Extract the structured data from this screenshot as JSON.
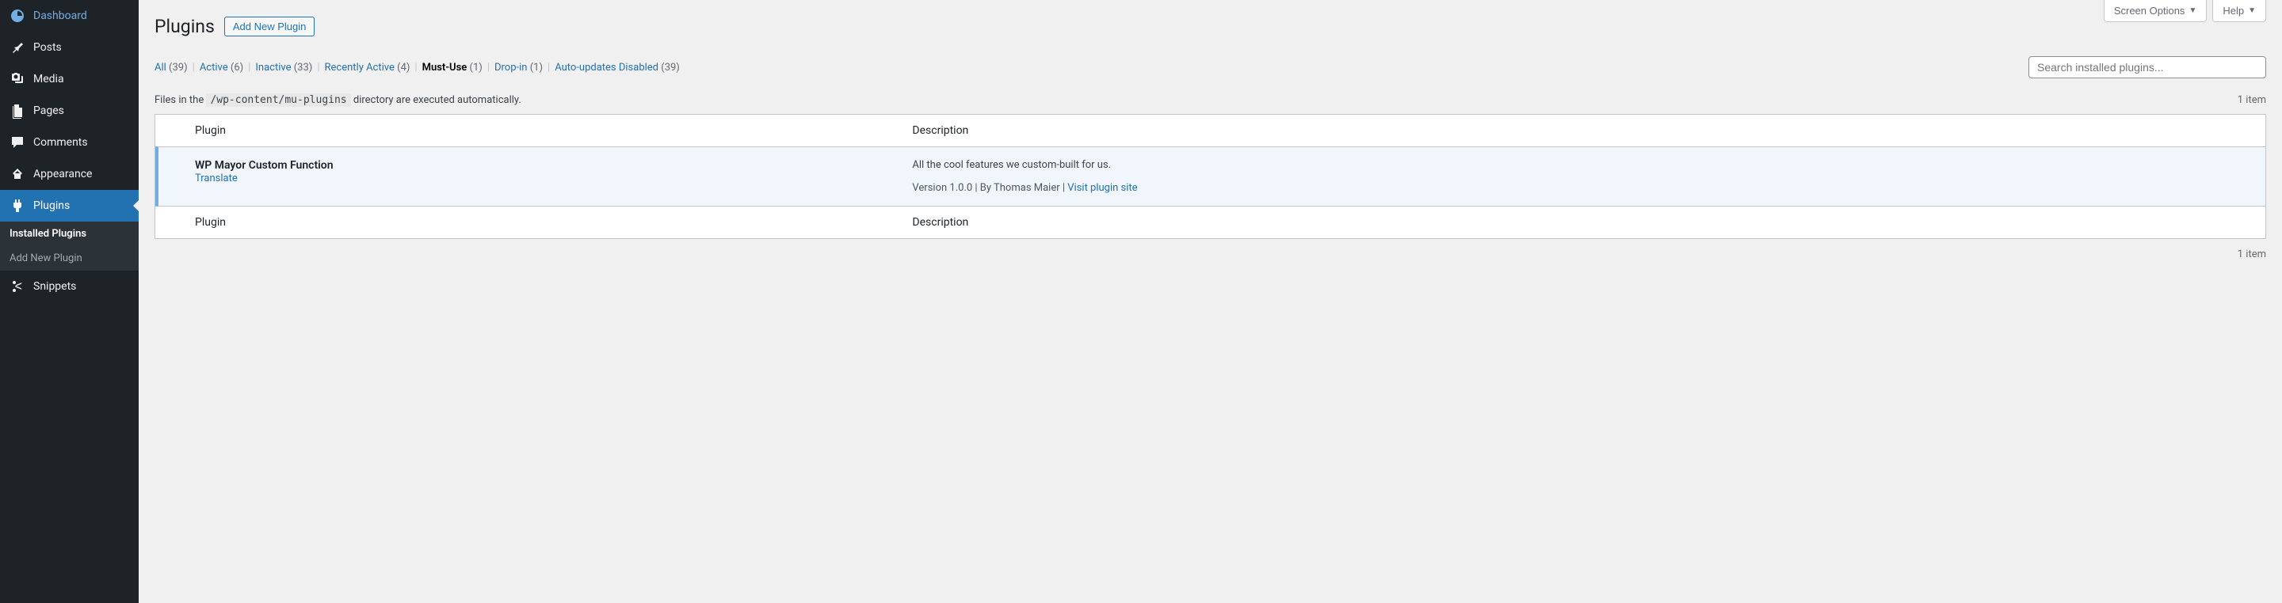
{
  "sidebar": {
    "items": [
      {
        "label": "Dashboard"
      },
      {
        "label": "Posts"
      },
      {
        "label": "Media"
      },
      {
        "label": "Pages"
      },
      {
        "label": "Comments"
      },
      {
        "label": "Appearance"
      },
      {
        "label": "Plugins"
      },
      {
        "label": "Snippets"
      }
    ],
    "submenu": [
      {
        "label": "Installed Plugins"
      },
      {
        "label": "Add New Plugin"
      }
    ]
  },
  "topButtons": {
    "screenOptions": "Screen Options",
    "help": "Help"
  },
  "page": {
    "title": "Plugins",
    "addNew": "Add New Plugin"
  },
  "filters": {
    "all": {
      "label": "All",
      "count": "(39)"
    },
    "active": {
      "label": "Active",
      "count": "(6)"
    },
    "inactive": {
      "label": "Inactive",
      "count": "(33)"
    },
    "recentlyActive": {
      "label": "Recently Active",
      "count": "(4)"
    },
    "mustUse": {
      "label": "Must-Use",
      "count": "(1)"
    },
    "dropIn": {
      "label": "Drop-in",
      "count": "(1)"
    },
    "autoUpdates": {
      "label": "Auto-updates Disabled",
      "count": "(39)"
    }
  },
  "search": {
    "placeholder": "Search installed plugins..."
  },
  "dirNote": {
    "prefix": "Files in the ",
    "code": "/wp-content/mu-plugins",
    "suffix": " directory are executed automatically."
  },
  "itemsCount": "1 item",
  "table": {
    "headers": {
      "plugin": "Plugin",
      "description": "Description"
    },
    "rows": [
      {
        "name": "WP Mayor Custom Function",
        "action": "Translate",
        "description": "All the cool features we custom-built for us.",
        "meta": {
          "version": "Version 1.0.0",
          "by": "By Thomas Maier",
          "link": "Visit plugin site"
        }
      }
    ]
  }
}
